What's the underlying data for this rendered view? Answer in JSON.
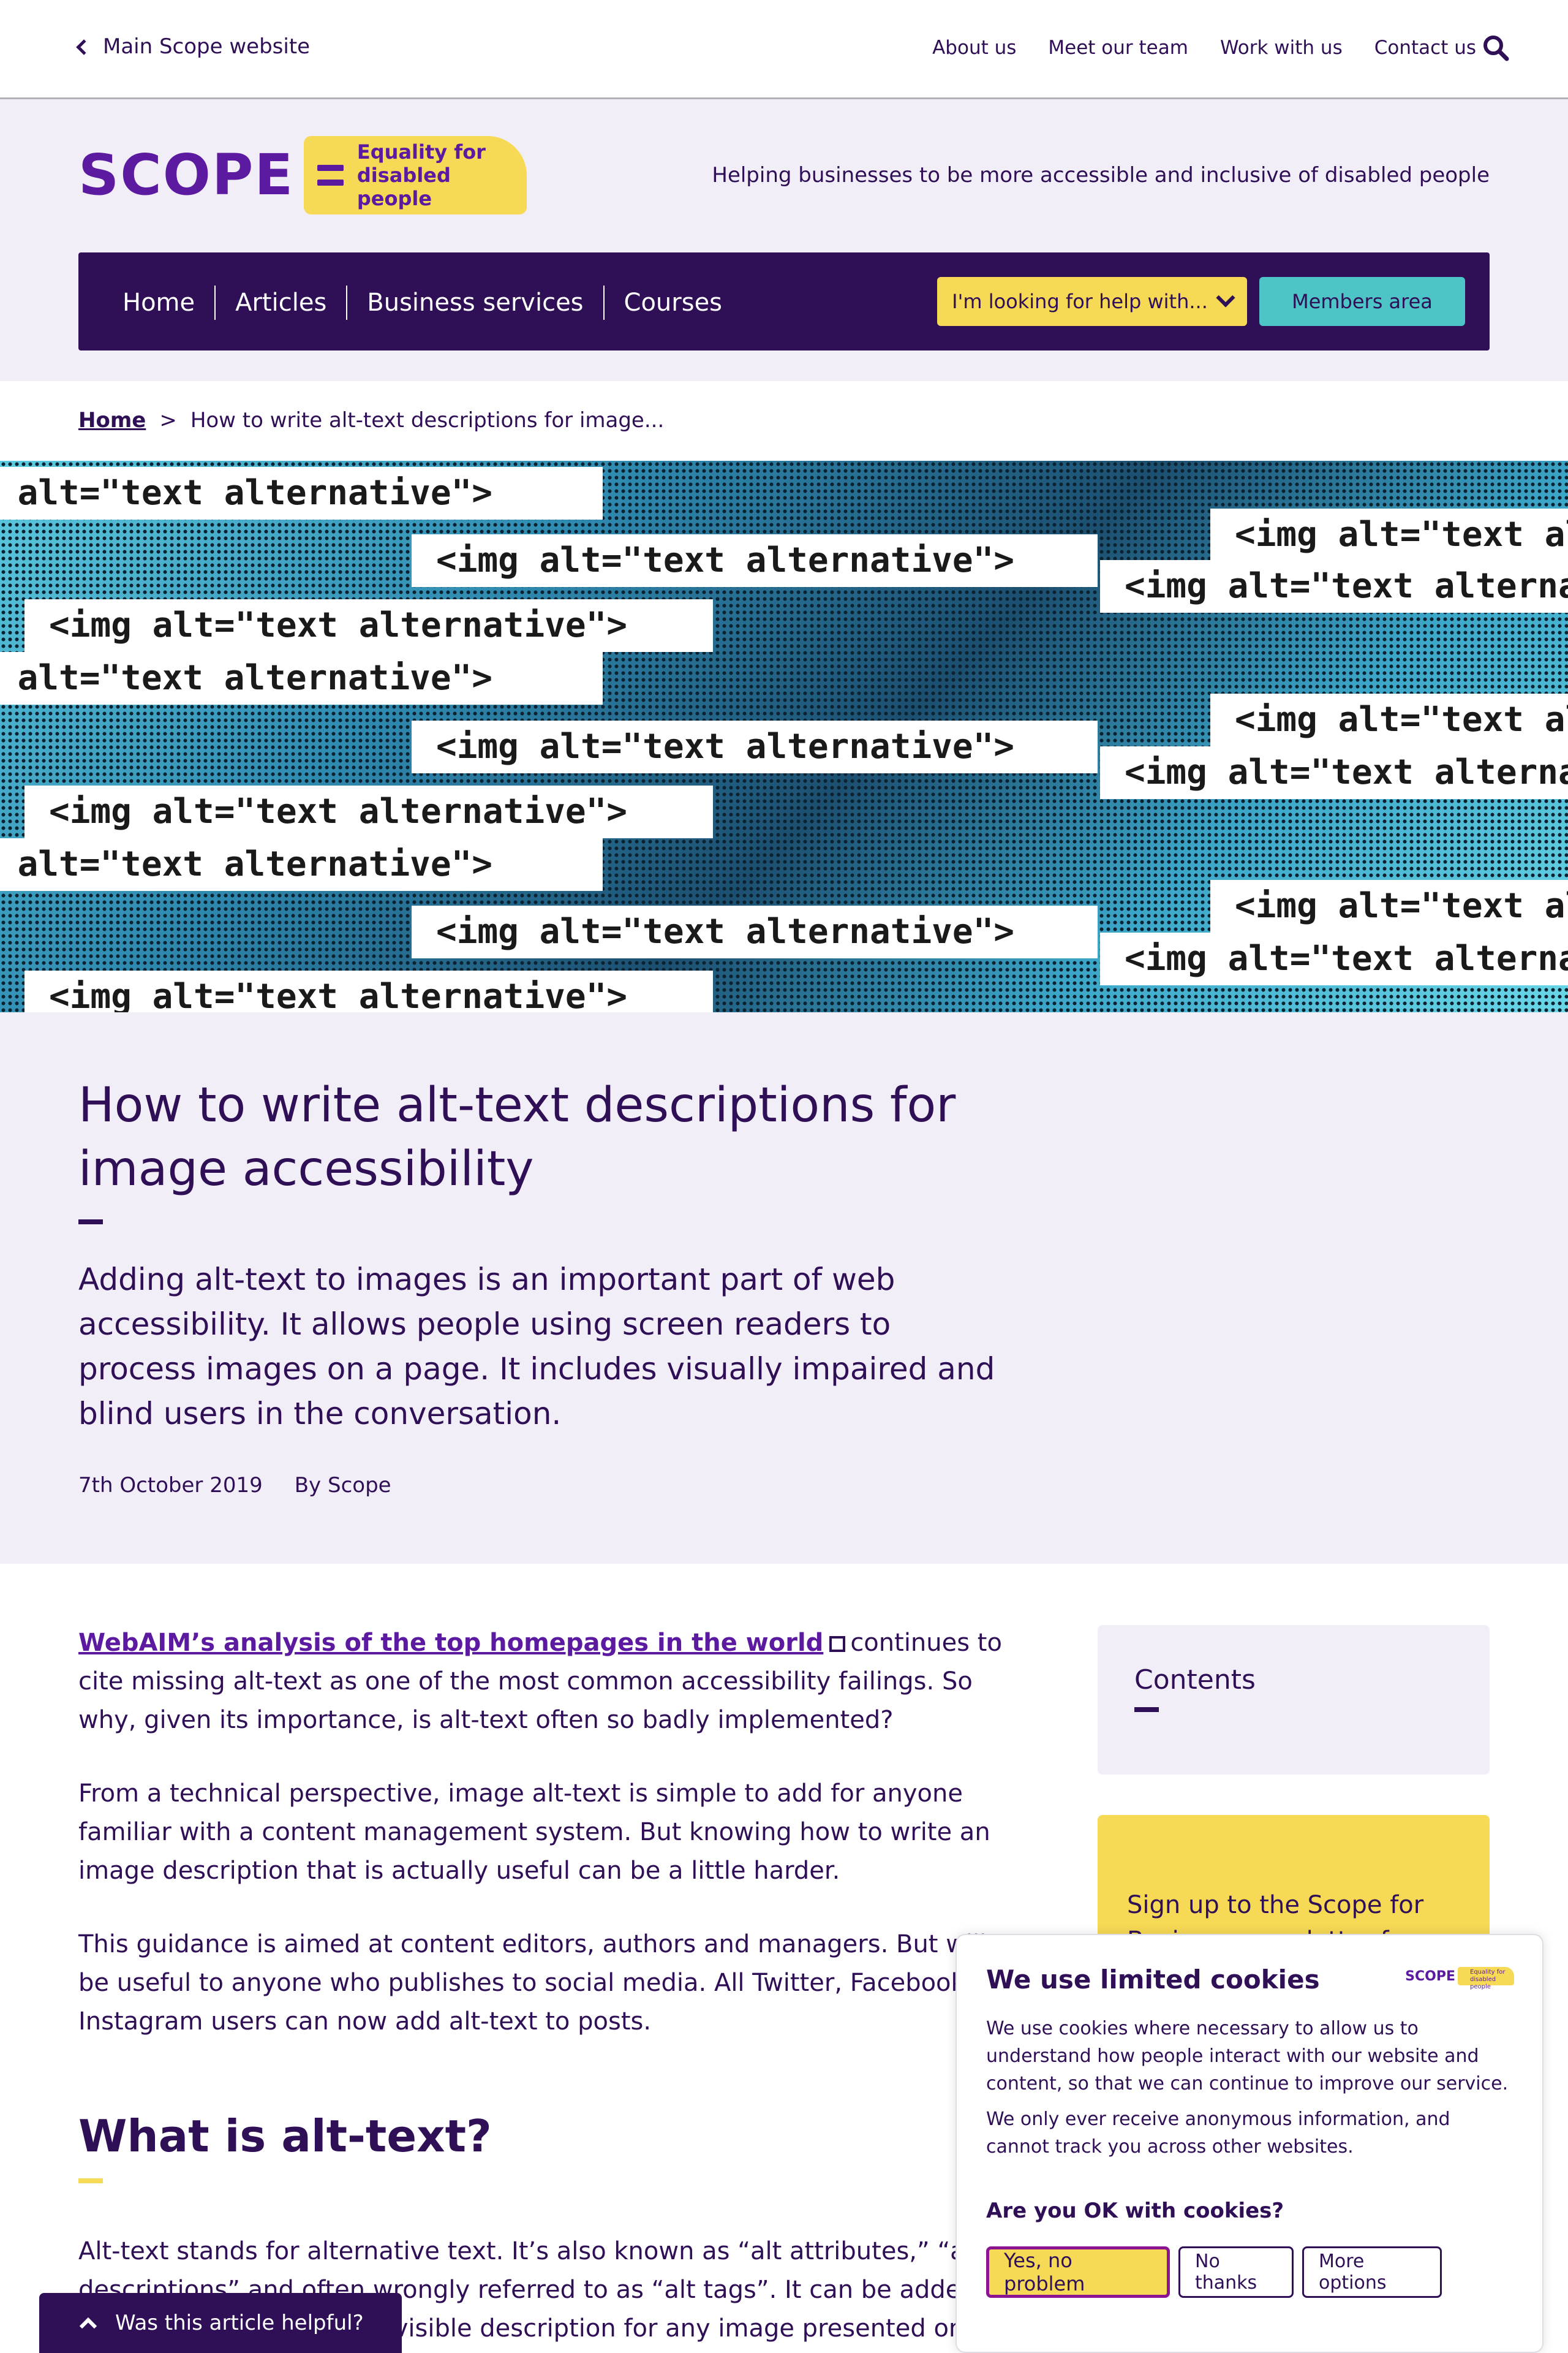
{
  "utility": {
    "back_label": "Main Scope website",
    "nav": [
      "About us",
      "Meet our team",
      "Work with us",
      "Contact us"
    ]
  },
  "header": {
    "logo_word": "SCOPE",
    "logo_tag_line1": "Equality for",
    "logo_tag_line2": "disabled people",
    "tagline": "Helping businesses to be more accessible and inclusive of disabled people",
    "nav": [
      "Home",
      "Articles",
      "Business services",
      "Courses"
    ],
    "help_button": "I'm looking for help with...",
    "members_button": "Members area"
  },
  "breadcrumb": {
    "home": "Home",
    "separator": ">",
    "current": "How to write alt-text descriptions for image..."
  },
  "hero": {
    "code_text": "<img alt=\"text alternative\">"
  },
  "article": {
    "title": "How to write alt-text descriptions for image accessibility",
    "intro": "Adding alt-text to images is an important part of web accessibility. It allows people using screen readers to process images on a page. It includes visually impaired and blind users in the conversation.",
    "date": "7th October 2019",
    "author": "By Scope",
    "p1_link": "WebAIM’s analysis of the top homepages in the world",
    "p1_rest": "continues to cite missing alt-text as one of the most common accessibility failings. So why, given its importance, is alt-text often so badly implemented?",
    "p2": "From a technical perspective, image alt-text is simple to add for anyone familiar with a content management system. But knowing how to write an image description that is actually useful can be a little harder.",
    "p3": "This guidance is aimed at content editors, authors and managers. But will be useful to anyone who publishes to social media. All Twitter, Facebook and Instagram users can now add alt-text to posts.",
    "h2": "What is alt-text?",
    "p4": "Alt-text stands for alternative text. It’s also known as “alt attributes,” “alt descriptions” and often wrongly referred to as “alt tags”. It can be added to an image to provide an invisible description for any image presented on"
  },
  "sidebar": {
    "contents_title": "Contents",
    "signup_text": "Sign up to the Scope for Business newsletter for"
  },
  "cookie": {
    "title": "We use limited cookies",
    "p1": "We use cookies where necessary to allow us to understand how people interact with our website and content, so that we can continue to improve our service.",
    "p2": "We only ever receive anonymous information, and cannot track you across other websites.",
    "question": "Are you OK with cookies?",
    "yes": "Yes, no problem",
    "no": "No thanks",
    "more": "More options",
    "logo_word": "SCOPE",
    "logo_tag": "Equality for disabled people"
  },
  "feedback": {
    "label": "Was this article helpful?"
  },
  "colors": {
    "purple": "#2f0f56",
    "brand_purple": "#5b1aa0",
    "lavender": "#f1eef8",
    "yellow": "#f6d955",
    "teal": "#4dc4c5"
  },
  "icons": [
    "chevron-left-icon",
    "search-icon",
    "chevron-down-icon",
    "external-link-icon",
    "chevron-up-icon"
  ]
}
